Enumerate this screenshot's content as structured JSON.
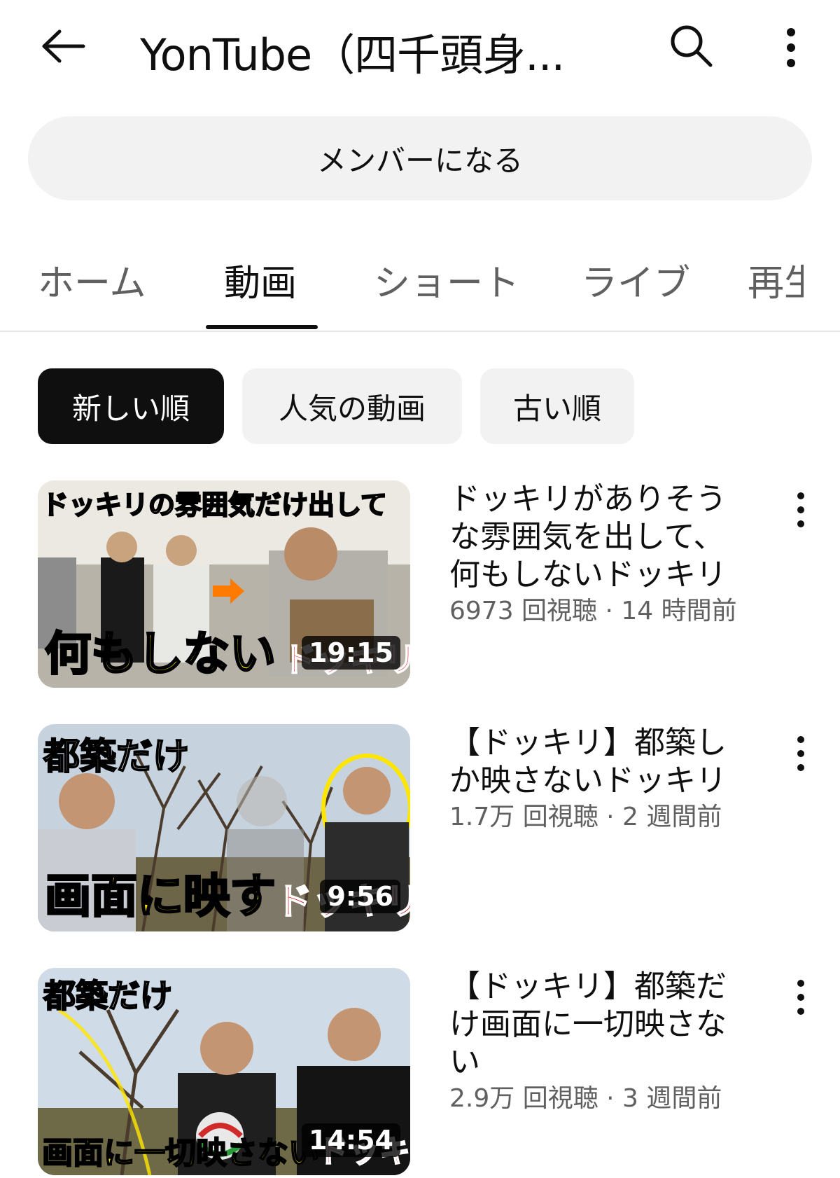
{
  "header": {
    "title": "YonTube（四千頭身...",
    "back_icon": "arrow-left-icon",
    "search_icon": "search-icon",
    "more_icon": "more-vert-icon"
  },
  "member_button": {
    "label": "メンバーになる"
  },
  "tabs": [
    {
      "label": "ホーム",
      "active": false
    },
    {
      "label": "動画",
      "active": true
    },
    {
      "label": "ショート",
      "active": false
    },
    {
      "label": "ライブ",
      "active": false
    },
    {
      "label": "再生",
      "active": false
    }
  ],
  "chips": [
    {
      "label": "新しい順",
      "selected": true
    },
    {
      "label": "人気の動画",
      "selected": false
    },
    {
      "label": "古い順",
      "selected": false
    }
  ],
  "videos": [
    {
      "title_lines": [
        "ドッキリがありそう",
        "な雰囲気を出して、",
        "何もしないドッキリ"
      ],
      "meta": "6973 回視聴 · 14 時間前",
      "duration": "19:15",
      "thumb_top_text": "ドッキリの雰囲気だけ出して",
      "thumb_bottom_text": "何もしない",
      "thumb_red_text": "ドッキリ"
    },
    {
      "title_lines": [
        "【ドッキリ】都築し",
        "か映さないドッキリ"
      ],
      "meta": "1.7万 回視聴 · 2 週間前",
      "duration": "9:56",
      "thumb_top_text": "都築だけ",
      "thumb_bottom_text": "画面に映す",
      "thumb_red_text": "ドッキリ"
    },
    {
      "title_lines": [
        "【ドッキリ】都築だ",
        "け画面に一切映さな",
        "い"
      ],
      "meta": "2.9万 回視聴 · 3 週間前",
      "duration": "14:54",
      "thumb_top_text": "都築だけ",
      "thumb_bottom_text": "画面に一切映さない",
      "thumb_red_text": "ドッキリ"
    }
  ],
  "colors": {
    "chip_selected_bg": "#0f0f0f",
    "chip_bg": "#f2f2f2",
    "meta_text": "#606060",
    "thumb_yellow": "#ffe600",
    "thumb_red": "#e01010"
  }
}
